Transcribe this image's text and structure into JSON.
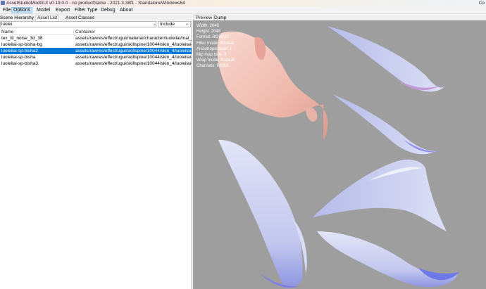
{
  "window": {
    "title": "AssetStudioModGUI v0.19.0.0 - no productName - 2021.3.38f1 - StandaloneWindows64",
    "right_fragment": "Co"
  },
  "menu": [
    "File",
    "Options",
    "Model",
    "Export",
    "Filter Type",
    "Debug",
    "About"
  ],
  "left_tabs": [
    "Scene Hierarchy",
    "Asset List",
    "Asset Classes"
  ],
  "filter": {
    "value": "luolei",
    "mode": "Include"
  },
  "columns": [
    "Name",
    "Container"
  ],
  "rows": [
    {
      "name": "tex_ttt_noise_3d_38",
      "container": "assets/rawres/effect/ugui/material/character/luoleilai/mat_l"
    },
    {
      "name": "luoleilai-sp-bisha-bg",
      "container": "assets/rawres/effect/ugui/skillspine/10044/skin_4/luoleilai-s"
    },
    {
      "name": "luoleilai-sp-bisha2",
      "container": "assets/rawres/effect/ugui/skillspine/10044/skin_4/luoleilai-s"
    },
    {
      "name": "luoleilai-sp-bisha",
      "container": "assets/rawres/effect/ugui/skillspine/10044/skin_4/luoleilai-s"
    },
    {
      "name": "luoleilai-sp-bisha3",
      "container": "assets/rawres/effect/ugui/skillspine/10044/skin_4/luoleilai-s"
    }
  ],
  "selected_row": 2,
  "right_tabs": [
    "Preview",
    "Dump"
  ],
  "preview_info": {
    "width": "Width: 2048",
    "height": "Height: 2048",
    "format": "Format: RGBA32",
    "filter": "Filter mode: Bilinear",
    "aniso": "Anisotropic level: 1",
    "mip": "Mip map bias: 0",
    "wrap": "Wrap mode: Repeat",
    "channels": "Channels: RGBA"
  },
  "colors": {
    "selection": "#0078d7",
    "preview_bg": "#9e9e9e",
    "texture_blue": "#c9cdf0",
    "texture_pink": "#f2c0b6"
  },
  "icons": [
    "app-icon",
    "dropdown-arrow-icon"
  ]
}
